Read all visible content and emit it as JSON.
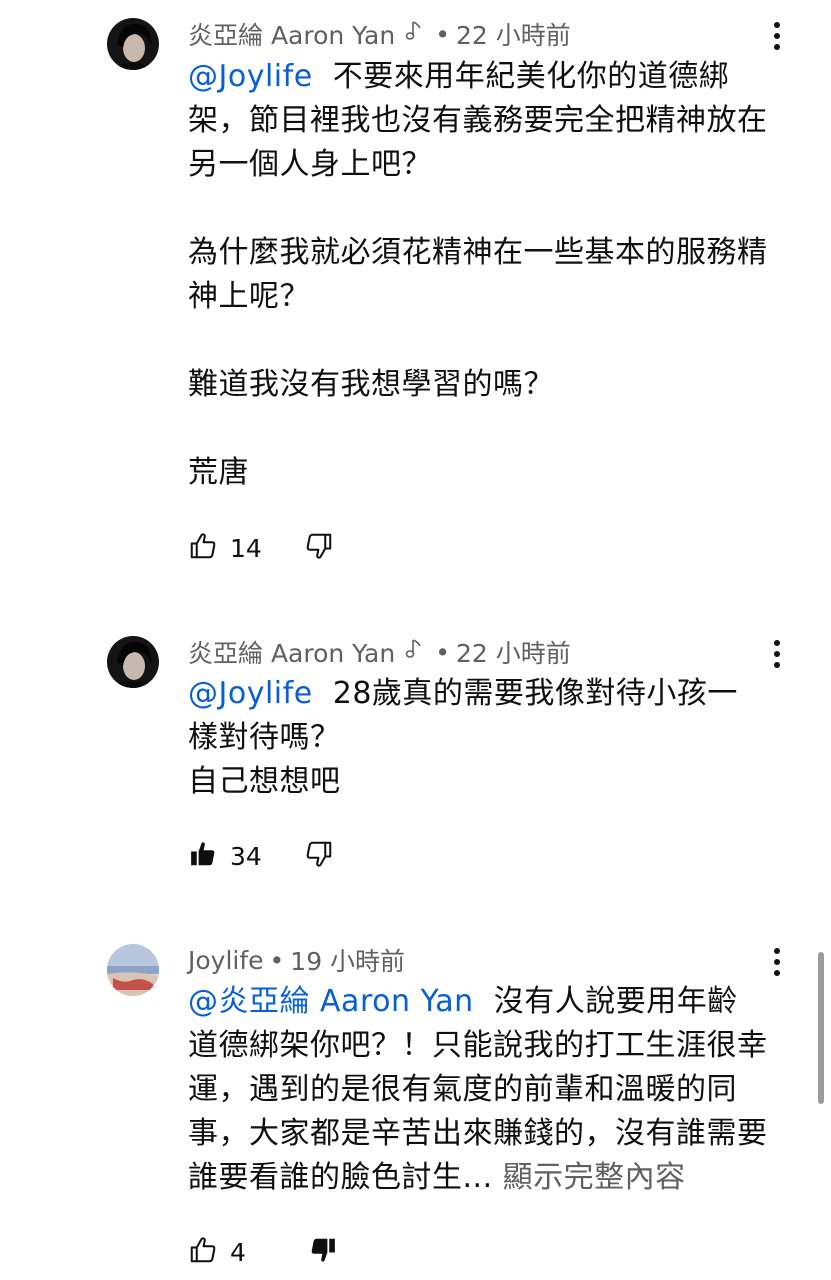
{
  "colors": {
    "text": "#0f0f0f",
    "secondary": "#606060",
    "mention": "#065fd4"
  },
  "comments": [
    {
      "author": "炎亞綸 Aaron Yan",
      "badge_icon": "music-note-icon",
      "separator": "•",
      "time": "22 小時前",
      "mention": "@Joylife",
      "text": "  不要來用年紀美化你的道德綁架，節目裡我也沒有義務要完全把精神放在另一個人身上吧？\n\n為什麼我就必須花精神在一些基本的服務精神上呢？\n\n難道我沒有我想學習的嗎？\n\n荒唐",
      "likes": "14",
      "liked": false,
      "disliked": false
    },
    {
      "author": "炎亞綸 Aaron Yan",
      "badge_icon": "music-note-icon",
      "separator": "•",
      "time": "22 小時前",
      "mention": "@Joylife",
      "text": "  28歲真的需要我像對待小孩一樣對待嗎？\n自己想想吧",
      "likes": "34",
      "liked": true,
      "disliked": false
    },
    {
      "author": "Joylife",
      "separator": "•",
      "time": "19 小時前",
      "mention": "@炎亞綸 Aaron Yan",
      "text": "  沒有人說要用年齡道德綁架你吧？！只能說我的打工生涯很幸運，遇到的是很有氣度的前輩和溫暖的同事，大家都是辛苦出來賺錢的，沒有誰需要誰要看誰的臉色討生... ",
      "show_more": "顯示完整內容",
      "likes": "4",
      "liked": false,
      "disliked": true
    }
  ]
}
